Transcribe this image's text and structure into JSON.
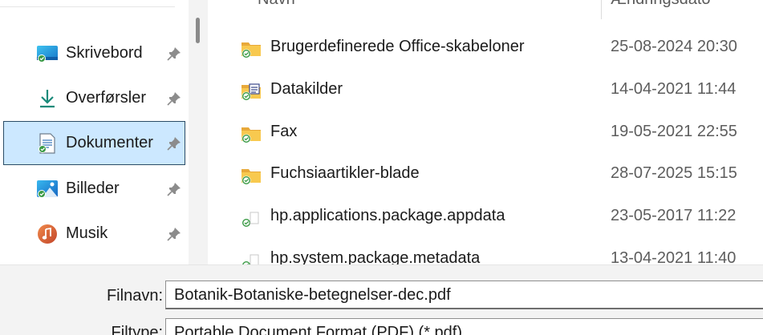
{
  "sidebar": {
    "items": [
      {
        "label": "Skrivebord",
        "icon": "desktop-icon",
        "pinned": true,
        "selected": false
      },
      {
        "label": "Overførsler",
        "icon": "download-arrow-icon",
        "pinned": true,
        "selected": false
      },
      {
        "label": "Dokumenter",
        "icon": "documents-icon",
        "pinned": true,
        "selected": true
      },
      {
        "label": "Billeder",
        "icon": "pictures-icon",
        "pinned": true,
        "selected": false
      },
      {
        "label": "Musik",
        "icon": "music-icon",
        "pinned": true,
        "selected": false
      }
    ]
  },
  "columns": {
    "name": "Navn",
    "date": "Ændringsdato"
  },
  "files": [
    {
      "name": "Brugerdefinerede Office-skabeloner",
      "date": "25-08-2024 20:30",
      "icon": "folder-synced-icon"
    },
    {
      "name": "Datakilder",
      "date": "14-04-2021 11:44",
      "icon": "data-sources-folder-icon"
    },
    {
      "name": "Fax",
      "date": "19-05-2021 22:55",
      "icon": "folder-synced-icon"
    },
    {
      "name": "Fuchsiaartikler-blade",
      "date": "28-07-2025 15:15",
      "icon": "folder-synced-icon"
    },
    {
      "name": "hp.applications.package.appdata",
      "date": "23-05-2017 11:22",
      "icon": "file-synced-icon"
    },
    {
      "name": "hp.system.package.metadata",
      "date": "13-04-2021 11:40",
      "icon": "file-synced-icon"
    }
  ],
  "filename": {
    "label": "Filnavn:",
    "value": "Botanik-Botaniske-betegnelser-dec.pdf"
  },
  "filetype": {
    "label": "Filtype:",
    "value": "Portable Document Format (PDF) (*.pdf)"
  },
  "colors": {
    "selected_bg": "#cce8ff",
    "selected_border": "#2b4c66",
    "folder_yellow": "#f5c342",
    "sync_green": "#3a9a45"
  }
}
